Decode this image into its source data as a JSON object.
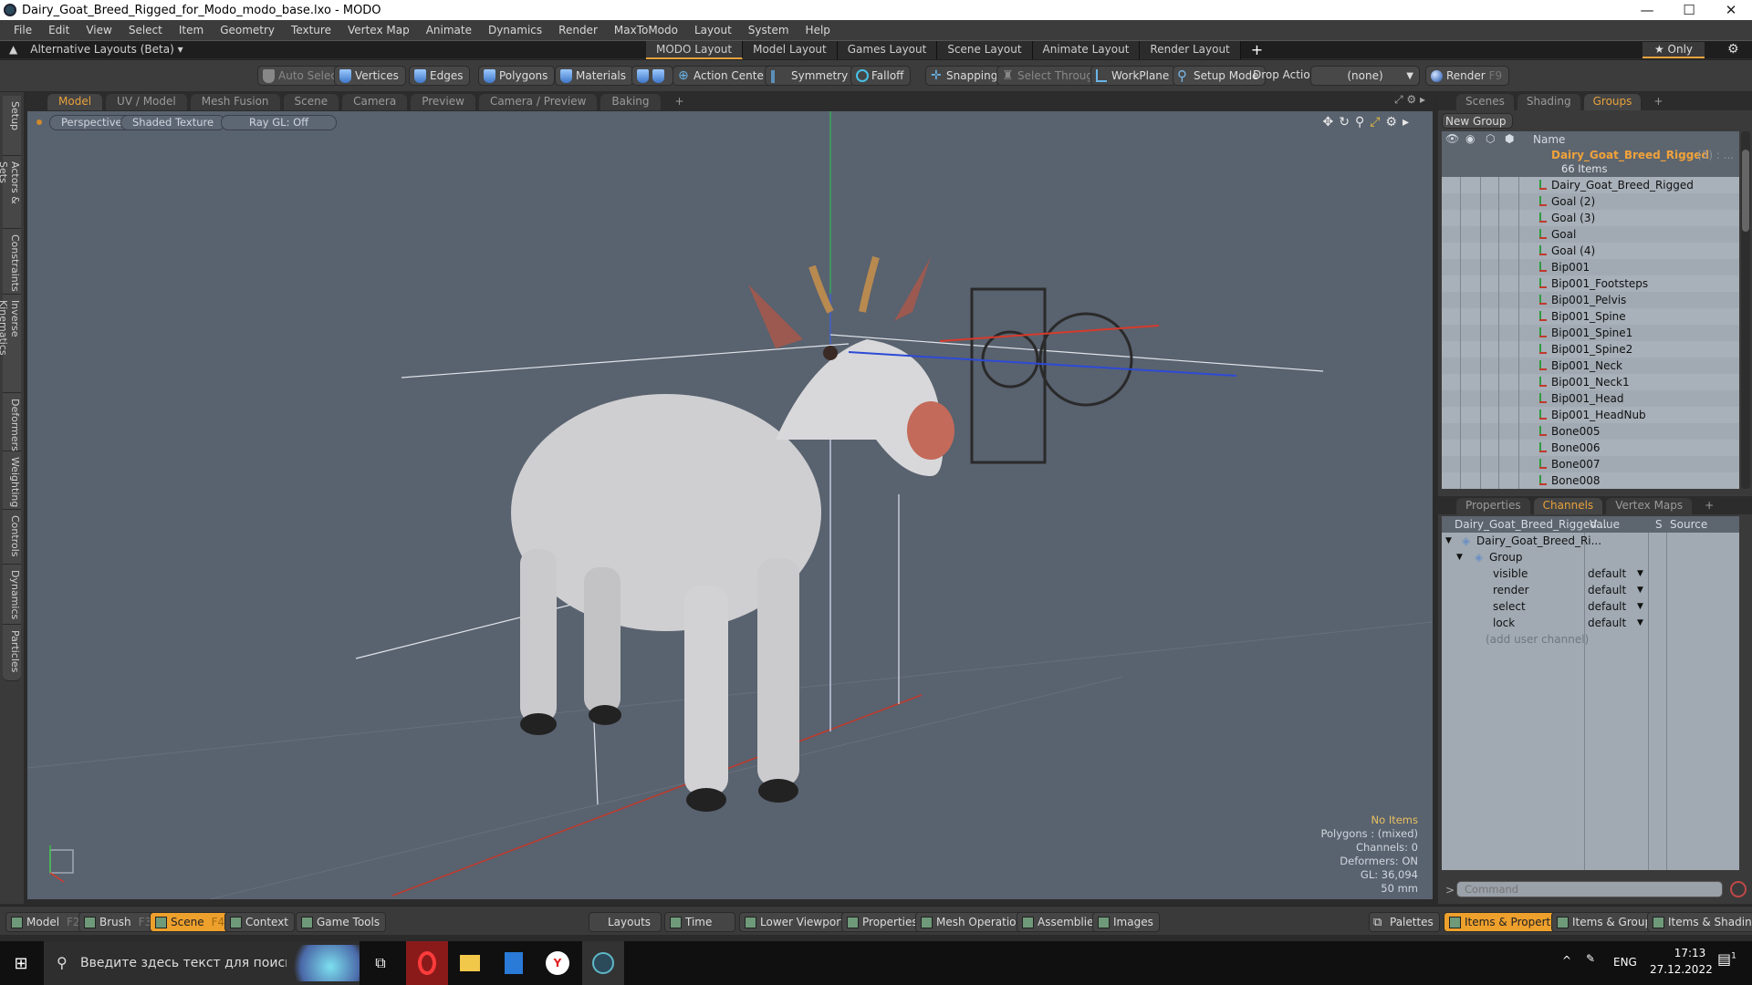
{
  "window": {
    "title": "Dairy_Goat_Breed_Rigged_for_Modo_modo_base.lxo - MODO"
  },
  "menu": [
    "File",
    "Edit",
    "View",
    "Select",
    "Item",
    "Geometry",
    "Texture",
    "Vertex Map",
    "Animate",
    "Dynamics",
    "Render",
    "MaxToModo",
    "Layout",
    "System",
    "Help"
  ],
  "layouts": {
    "alt_label": "Alternative Layouts (Beta) ▾",
    "tabs": [
      "MODO Layout",
      "Model Layout",
      "Games Layout",
      "Scene Layout",
      "Animate Layout",
      "Render Layout"
    ],
    "active": "MODO Layout",
    "add": "+",
    "only": "★ Only"
  },
  "toolbar": {
    "auto_select": "Auto Select",
    "vertices": "Vertices",
    "edges": "Edges",
    "polygons": "Polygons",
    "materials": "Materials",
    "action_center": "Action Center",
    "symmetry": "Symmetry",
    "falloff": "Falloff",
    "snapping": "Snapping",
    "select_through": "Select Through",
    "workplane": "WorkPlane",
    "setup_mode": "Setup Mode",
    "drop_action_label": "Drop Action",
    "drop_action_value": "(none)",
    "render": "Render",
    "render_key": "F9"
  },
  "viewport_tabs": [
    "Model",
    "UV / Model",
    "Mesh Fusion",
    "Scene",
    "Camera",
    "Preview",
    "Camera / Preview",
    "Baking"
  ],
  "viewport_active": "Model",
  "side_tabs": [
    "Setup",
    "Actors & Sets",
    "Constraints",
    "Inverse Kinematics",
    "Deformers",
    "Weighting",
    "Controls",
    "Dynamics",
    "Particles"
  ],
  "viewport": {
    "projection": "Perspective",
    "shading": "Shaded Texture",
    "raygl": "Ray GL: Off",
    "hud": {
      "selection": "No Items",
      "polygons": "Polygons : (mixed)",
      "channels": "Channels: 0",
      "deformers": "Deformers: ON",
      "gl": "GL: 36,094",
      "focal": "50 mm"
    },
    "accent": "#e8c060"
  },
  "groups_panel": {
    "tabs": [
      "Scenes",
      "Shading",
      "Groups"
    ],
    "active": "Groups",
    "new_group": "New Group",
    "col_name": "Name",
    "group_name": "Dairy_Goat_Breed_Rigged",
    "group_count": "(3) : ...",
    "group_items": "66 Items",
    "items": [
      "Dairy_Goat_Breed_Rigged",
      "Goal (2)",
      "Goal (3)",
      "Goal",
      "Goal (4)",
      "Bip001",
      "Bip001_Footsteps",
      "Bip001_Pelvis",
      "Bip001_Spine",
      "Bip001_Spine1",
      "Bip001_Spine2",
      "Bip001_Neck",
      "Bip001_Neck1",
      "Bip001_Head",
      "Bip001_HeadNub",
      "Bone005",
      "Bone006",
      "Bone007",
      "Bone008"
    ]
  },
  "channels_panel": {
    "tabs": [
      "Properties",
      "Channels",
      "Vertex Maps"
    ],
    "active": "Channels",
    "headers": {
      "name": "Dairy_Goat_Breed_Rigged...",
      "value": "Value",
      "s": "S",
      "source": "Source"
    },
    "root": "Dairy_Goat_Breed_Ri...",
    "group": "Group",
    "channels": [
      {
        "name": "visible",
        "value": "default"
      },
      {
        "name": "render",
        "value": "default"
      },
      {
        "name": "select",
        "value": "default"
      },
      {
        "name": "lock",
        "value": "default"
      }
    ],
    "add_channel": "(add user channel)"
  },
  "command": {
    "placeholder": "Command"
  },
  "bottombar": {
    "left": [
      {
        "label": "Model",
        "key": "F2"
      },
      {
        "label": "Brush",
        "key": "F3"
      },
      {
        "label": "Scene",
        "key": "F4",
        "active": true
      },
      {
        "label": "Context",
        "key": ""
      },
      {
        "label": "Game Tools",
        "key": ""
      }
    ],
    "center": [
      "Layouts",
      "Time",
      "Lower Viewports",
      "Properties",
      "Mesh Operations",
      "Assemblies",
      "Images"
    ],
    "right": [
      "Palettes",
      "Items & Properties",
      "Items & Groups",
      "Items & Shading"
    ],
    "right_active": "Items & Properties"
  },
  "taskbar": {
    "search_placeholder": "Введите здесь текст для поиска",
    "lang": "ENG",
    "time": "17:13",
    "date": "27.12.2022",
    "notifications": "1"
  },
  "colors": {
    "accent": "#e8a23c",
    "viewport_bg": "#59626f",
    "tree_bg": "#9aa3ad"
  }
}
